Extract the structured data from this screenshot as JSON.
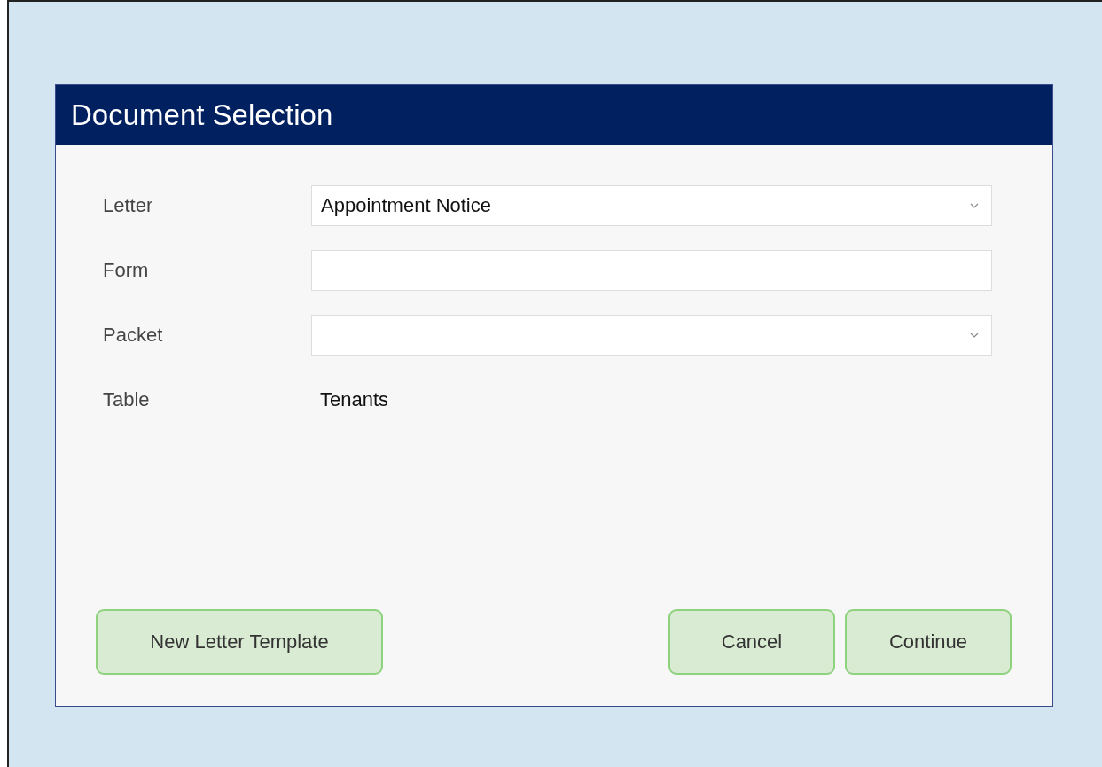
{
  "dialog": {
    "title": "Document Selection"
  },
  "fields": [
    {
      "label": "Letter",
      "kind": "dropdown",
      "value": "Appointment Notice"
    },
    {
      "label": "Form",
      "kind": "text"
    },
    {
      "label": "Packet",
      "kind": "dropdown"
    },
    {
      "label": "Table",
      "kind": "static",
      "value": "Tenants"
    }
  ],
  "left_buttons": [
    "New Letter Template"
  ],
  "right_buttons": [
    "Cancel",
    "Continue"
  ]
}
